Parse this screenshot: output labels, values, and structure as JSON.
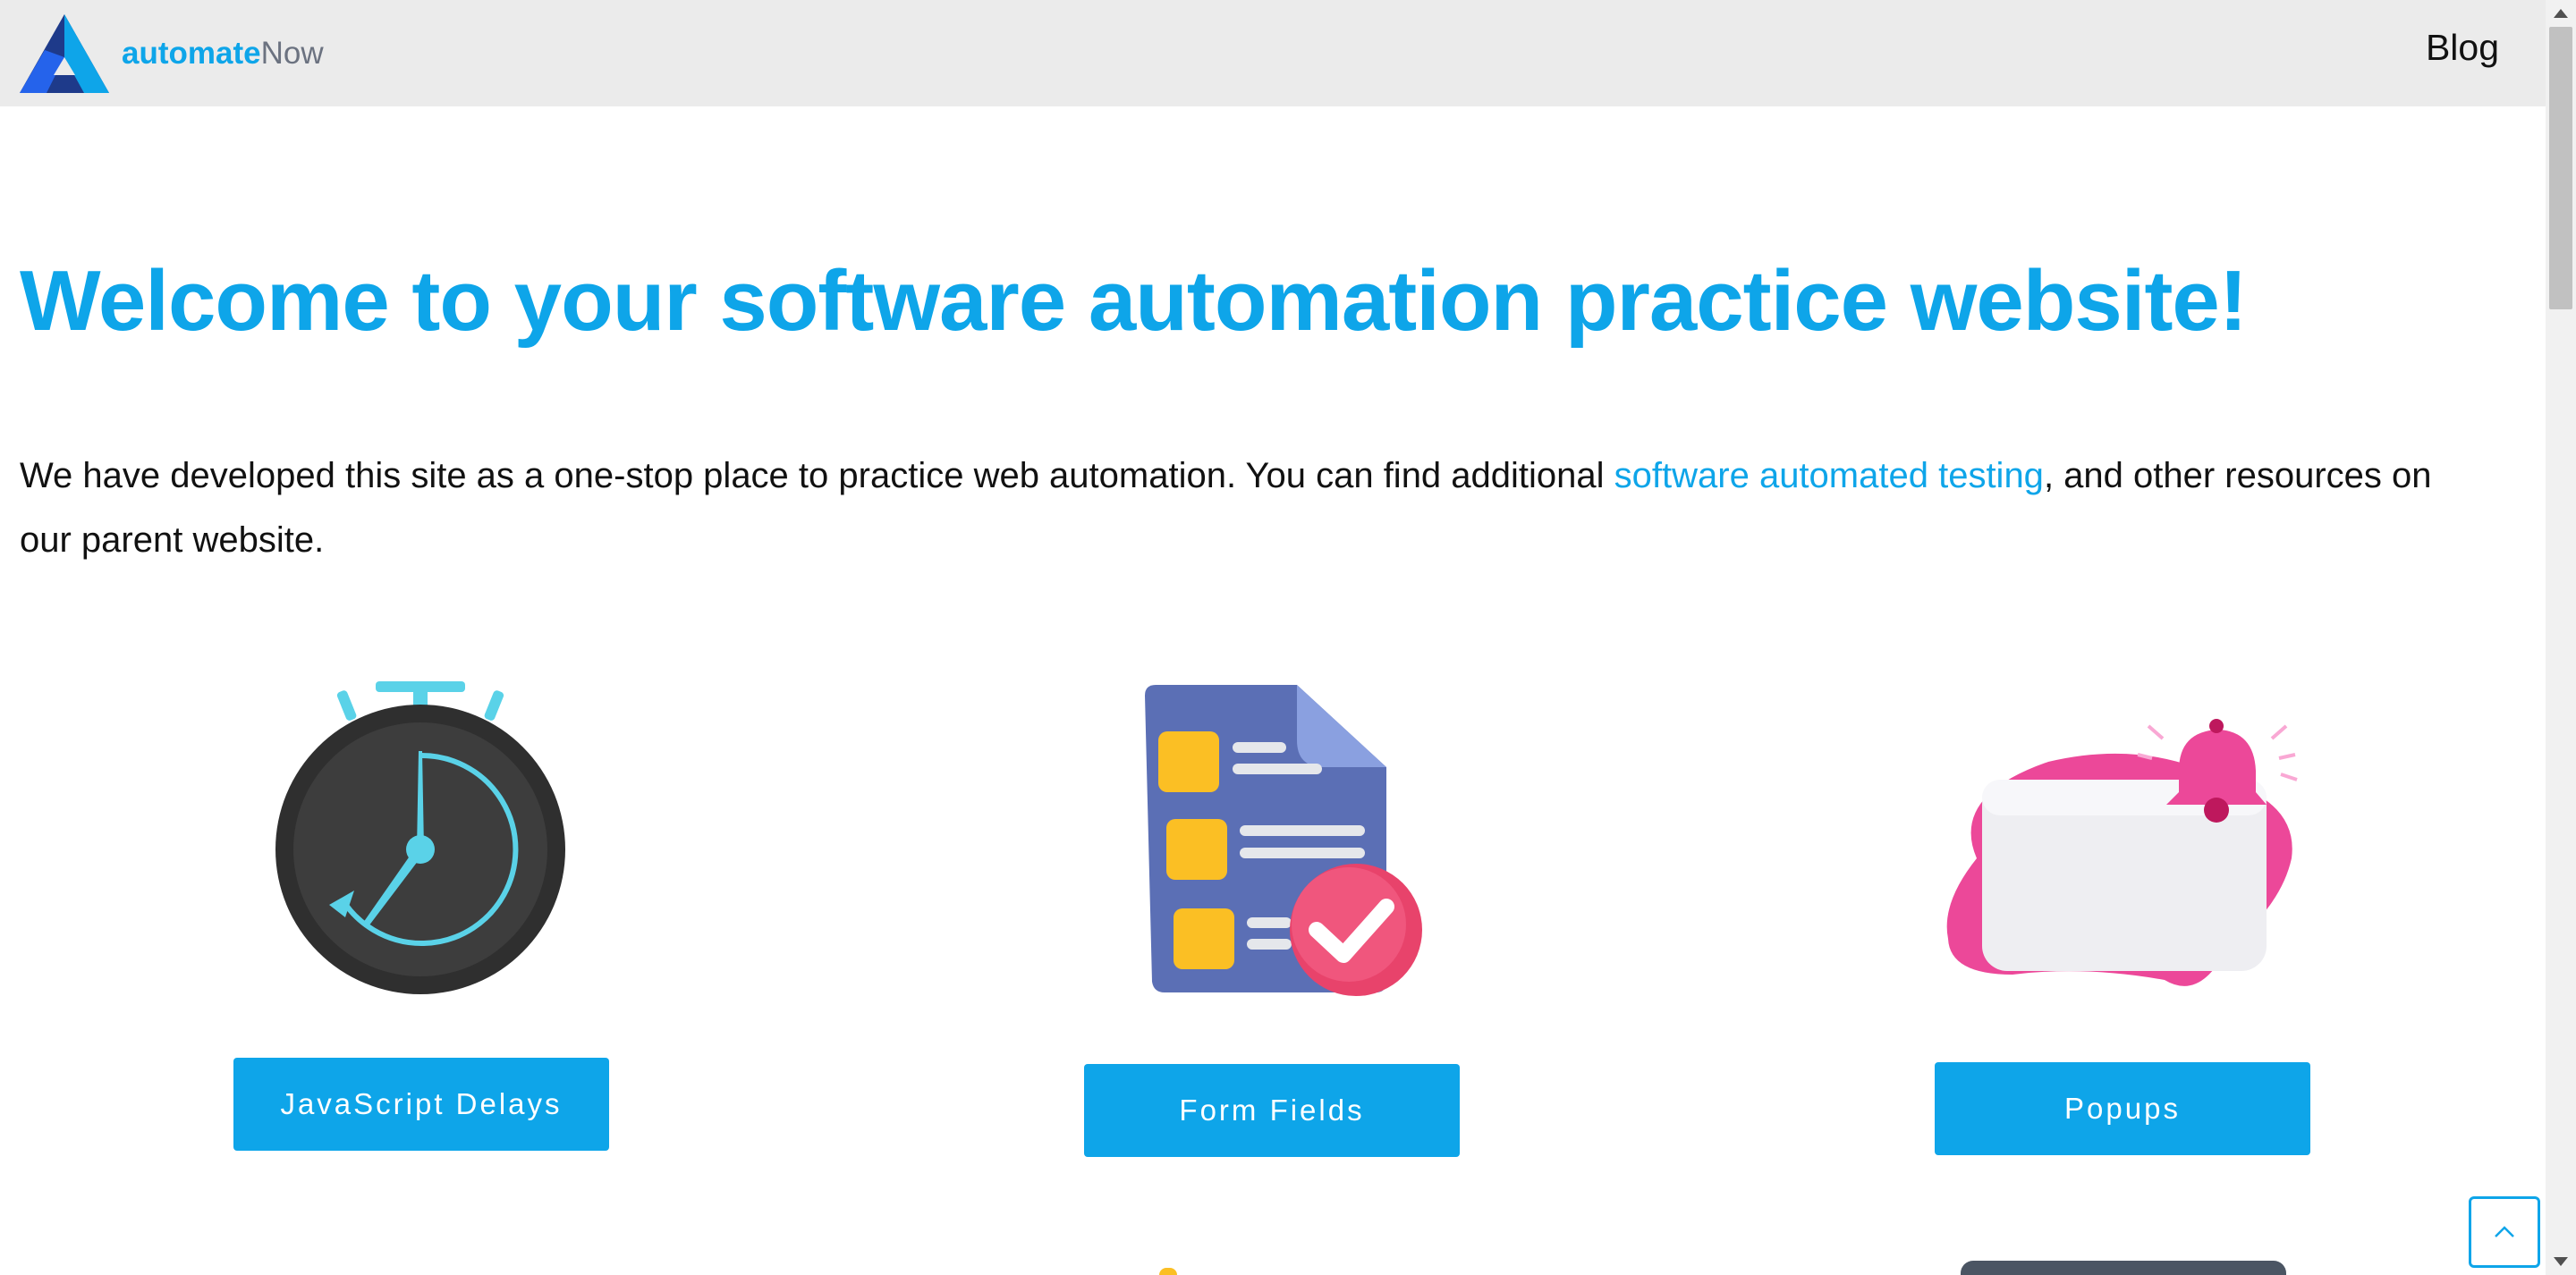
{
  "header": {
    "logo_primary": "automate",
    "logo_secondary": "Now",
    "nav_blog": "Blog"
  },
  "main": {
    "title": "Welcome to your software automation practice website!",
    "intro_before": "We have developed this site as a one-stop place to practice web automation. You can find additional ",
    "intro_link": "software automated testing",
    "intro_after": ", and other resources on our parent website."
  },
  "cards": [
    {
      "label": "JavaScript Delays",
      "icon": "stopwatch-icon"
    },
    {
      "label": "Form Fields",
      "icon": "form-checklist-icon"
    },
    {
      "label": "Popups",
      "icon": "notification-bell-icon"
    }
  ],
  "back_to_top_icon": "chevron-up-icon",
  "colors": {
    "accent": "#0ea5e9",
    "header_bg": "#ebebeb"
  }
}
